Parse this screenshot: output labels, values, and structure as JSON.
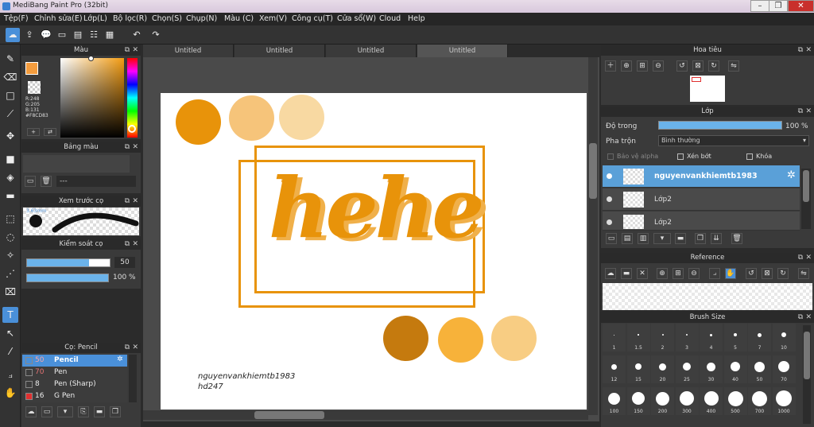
{
  "window": {
    "title": "MediBang Paint Pro (32bit)"
  },
  "menu": [
    "Tệp(F)",
    "Chỉnh sửa(E)",
    "Lớp(L)",
    "Bộ lọc(R)",
    "Chọn(S)",
    "Chụp(N)",
    "Màu (C)",
    "Xem(V)",
    "Công cụ(T)",
    "Cửa sổ(W)",
    "Cloud",
    "Help"
  ],
  "tabs": [
    "Untitled",
    "Untitled",
    "Untitled",
    "Untitled"
  ],
  "color_panel": {
    "title": "Màu",
    "r": "R:248",
    "g": "G:205",
    "b": "B:131",
    "hex": "#F8CD83",
    "primary": "#f39c3e",
    "selected": "#F8CD83"
  },
  "palette_panel": {
    "title": "Bảng màu",
    "field": "---"
  },
  "brush_preview": {
    "title": "Xem trước cọ",
    "size": "3.63mm"
  },
  "control_panel": {
    "title": "Kiểm soát cọ",
    "size": "50",
    "opacity": "100 %"
  },
  "brush_panel": {
    "title": "Cọ: Pencil",
    "brushes": [
      {
        "size": "50",
        "name": "Pencil",
        "color": "#2a2a2a"
      },
      {
        "size": "70",
        "name": "Pen",
        "color": "#2a2a2a"
      },
      {
        "size": "8",
        "name": "Pen (Sharp)",
        "color": "#2a2a2a"
      },
      {
        "size": "16",
        "name": "G Pen",
        "color": "#e03030"
      }
    ]
  },
  "canvas": {
    "text": "hehe",
    "signature_line1": "nguyenvankhiemtb1983",
    "signature_line2": "hd247",
    "top_circles": [
      "#e8930a",
      "#f6c47a",
      "#f8d9a2"
    ],
    "bottom_circles": [
      "#c57a0e",
      "#f7b23a",
      "#f8cd83"
    ],
    "accent": "#e8930a"
  },
  "navigator": {
    "title": "Hoa tiêu"
  },
  "layers": {
    "title": "Lớp",
    "opacity_label": "Độ trong",
    "opacity_value": "100 %",
    "blend_label": "Pha trộn",
    "blend_value": "Bình thường",
    "protect_alpha": "Bảo vệ alpha",
    "clipping": "Xén bớt",
    "lock": "Khóa",
    "items": [
      "nguyenvankhiemtb1983",
      "Lớp2",
      "Lớp2"
    ]
  },
  "reference": {
    "title": "Reference"
  },
  "brush_size": {
    "title": "Brush Size",
    "sizes": [
      "1",
      "1.5",
      "2",
      "3",
      "4",
      "5",
      "7",
      "10",
      "12",
      "15",
      "20",
      "25",
      "30",
      "40",
      "50",
      "70",
      "100",
      "150",
      "200",
      "300",
      "400",
      "500",
      "700",
      "1000"
    ]
  }
}
